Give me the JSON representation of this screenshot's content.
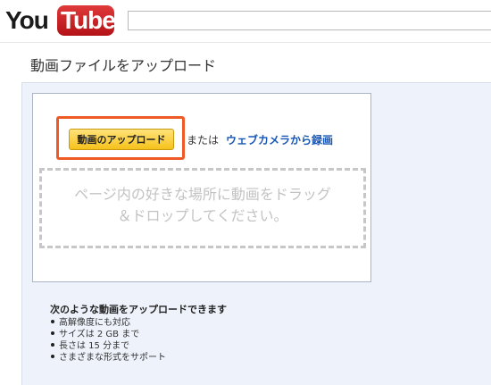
{
  "header": {
    "logo_you": "You",
    "logo_tube": "Tube",
    "search_value": ""
  },
  "page": {
    "title": "動画ファイルをアップロード"
  },
  "upload": {
    "button_label": "動画のアップロード",
    "or_text": "または",
    "webcam_link": "ウェブカメラから録画",
    "drop_text_line1": "ページ内の好きな場所に動画をドラッグ",
    "drop_text_line2": "＆ドロップしてください。"
  },
  "requirements": {
    "title": "次のような動画をアップロードできます",
    "items": [
      "高解像度にも対応",
      "サイズは 2 GB まで",
      "長さは 15 分まで",
      "さまざまな形式をサポート"
    ]
  },
  "colors": {
    "brand_red": "#cc181e",
    "button_yellow": "#f6c21b",
    "highlight_orange": "#ee5a26",
    "link_blue": "#1756b4",
    "panel_bg": "#eef3fb"
  }
}
